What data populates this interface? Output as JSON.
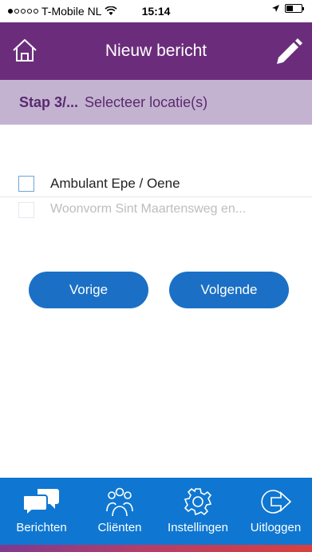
{
  "status_bar": {
    "carrier": "T-Mobile NL",
    "time": "15:14"
  },
  "header": {
    "title": "Nieuw bericht",
    "background": "#6b2d7b"
  },
  "step_bar": {
    "step": "Stap 3/...",
    "instruction": "Selecteer locatie(s)"
  },
  "locations": [
    {
      "label": "Ambulant Epe / Oene",
      "checked": false,
      "enabled": true
    },
    {
      "label": "Woonvorm Sint Maartensweg en...",
      "checked": false,
      "enabled": false
    }
  ],
  "buttons": {
    "previous": "Vorige",
    "next": "Volgende"
  },
  "tab_bar": {
    "items": [
      {
        "label": "Berichten",
        "icon": "chat-bubbles-icon"
      },
      {
        "label": "Cliënten",
        "icon": "people-icon"
      },
      {
        "label": "Instellingen",
        "icon": "gear-icon"
      },
      {
        "label": "Uitloggen",
        "icon": "logout-icon"
      }
    ]
  },
  "colors": {
    "header": "#6b2d7b",
    "step_bar": "#c3b3d0",
    "button": "#1b70c6",
    "tab_bar": "#0f77d1"
  }
}
